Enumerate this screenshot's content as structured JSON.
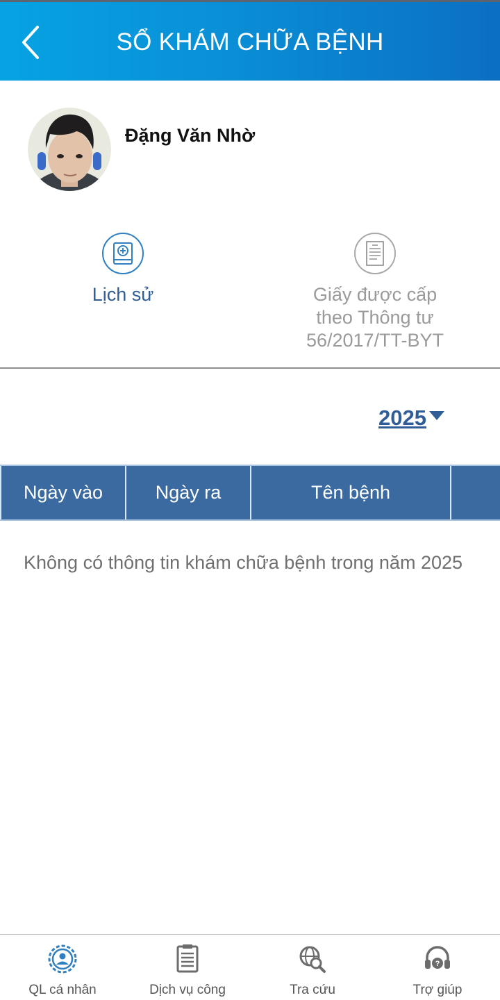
{
  "header": {
    "title": "SỔ KHÁM CHỮA BỆNH"
  },
  "user": {
    "name": "Đặng Văn Nhờ"
  },
  "actions": {
    "history_label": "Lịch sử",
    "certificate_label": "Giấy được cấp\ntheo Thông tư\n56/2017/TT-BYT"
  },
  "year_filter": {
    "selected": "2025"
  },
  "table": {
    "columns": [
      "Ngày vào",
      "Ngày ra",
      "Tên bệnh",
      ""
    ]
  },
  "empty_message": "Không có thông tin khám chữa bệnh trong năm 2025",
  "bottom_nav": {
    "items": [
      {
        "label": "QL cá nhân",
        "icon": "personal-gear-icon"
      },
      {
        "label": "Dịch vụ công",
        "icon": "document-icon"
      },
      {
        "label": "Tra cứu",
        "icon": "globe-search-icon"
      },
      {
        "label": "Trợ giúp",
        "icon": "headset-help-icon"
      }
    ]
  },
  "colors": {
    "header_start": "#06a3e3",
    "header_end": "#0b6fc2",
    "primary": "#2f5d95",
    "table_header": "#3b6aa0"
  }
}
